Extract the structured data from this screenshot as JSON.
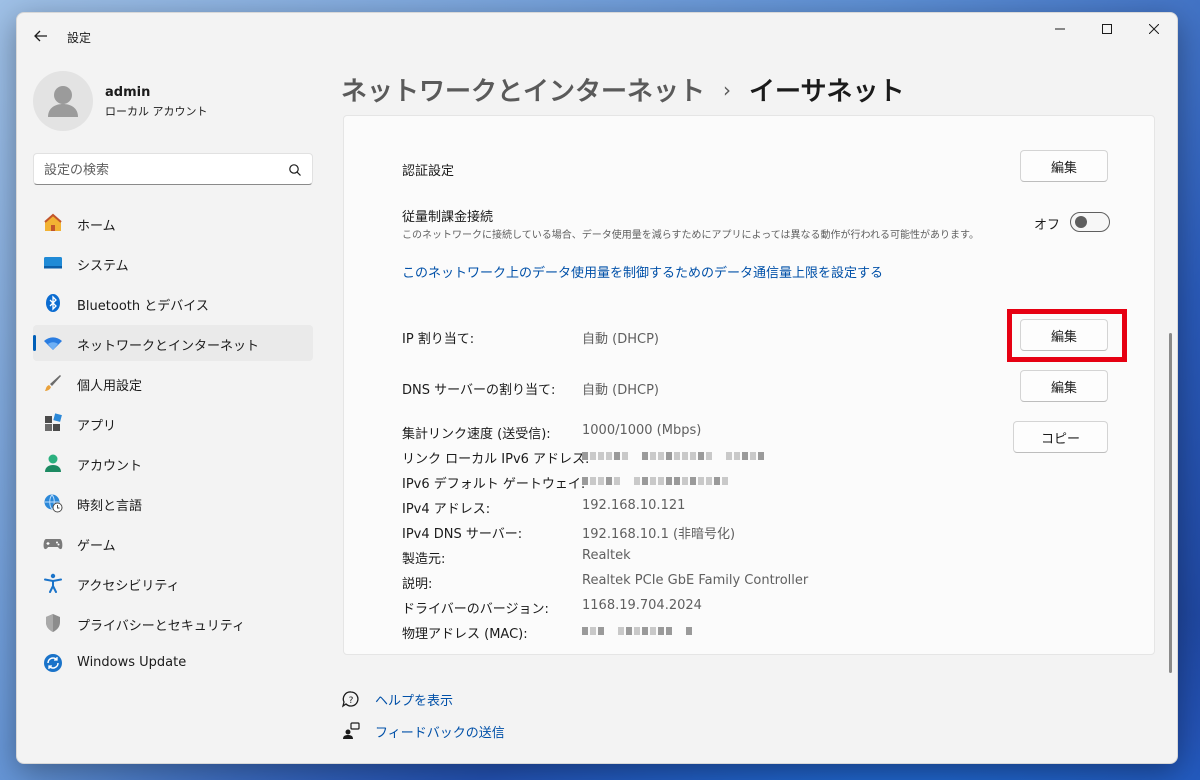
{
  "window": {
    "title": "設定"
  },
  "profile": {
    "name": "admin",
    "account_type": "ローカル アカウント"
  },
  "search": {
    "placeholder": "設定の検索"
  },
  "sidebar": {
    "items": [
      {
        "label": "ホーム",
        "icon": "home-icon"
      },
      {
        "label": "システム",
        "icon": "system-icon"
      },
      {
        "label": "Bluetooth とデバイス",
        "icon": "bluetooth-icon"
      },
      {
        "label": "ネットワークとインターネット",
        "icon": "wifi-icon",
        "active": true
      },
      {
        "label": "個人用設定",
        "icon": "brush-icon"
      },
      {
        "label": "アプリ",
        "icon": "apps-icon"
      },
      {
        "label": "アカウント",
        "icon": "account-icon"
      },
      {
        "label": "時刻と言語",
        "icon": "globe-clock-icon"
      },
      {
        "label": "ゲーム",
        "icon": "gamepad-icon"
      },
      {
        "label": "アクセシビリティ",
        "icon": "accessibility-icon"
      },
      {
        "label": "プライバシーとセキュリティ",
        "icon": "shield-icon"
      },
      {
        "label": "Windows Update",
        "icon": "update-icon"
      }
    ]
  },
  "header": {
    "parent": "ネットワークとインターネット",
    "separator": "›",
    "current": "イーサネット"
  },
  "settings": {
    "auth": {
      "label": "認証設定",
      "button": "編集"
    },
    "metered": {
      "label": "従量制課金接続",
      "description": "このネットワークに接続している場合、データ使用量を減らすためにアプリによっては異なる動作が行われる可能性があります。",
      "toggle_state": "オフ",
      "toggle_on": false
    },
    "data_limit_link": "このネットワーク上のデータ使用量を制御するためのデータ通信量上限を設定する",
    "ip_assign": {
      "label": "IP 割り当て:",
      "value": "自動 (DHCP)",
      "button": "編集"
    },
    "dns_assign": {
      "label": "DNS サーバーの割り当て:",
      "value": "自動 (DHCP)",
      "button": "編集"
    },
    "copy_button": "コピー",
    "properties": [
      {
        "label": "集計リンク速度 (送受信):",
        "value": "1000/1000 (Mbps)"
      },
      {
        "label": "リンク ローカル IPv6 アドレス:",
        "value": ""
      },
      {
        "label": "IPv6 デフォルト ゲートウェイ:",
        "value": ""
      },
      {
        "label": "IPv4 アドレス:",
        "value": "192.168.10.121"
      },
      {
        "label": "IPv4 DNS サーバー:",
        "value": "192.168.10.1 (非暗号化)"
      },
      {
        "label": "製造元:",
        "value": "Realtek"
      },
      {
        "label": "説明:",
        "value": "Realtek PCIe GbE Family Controller"
      },
      {
        "label": "ドライバーのバージョン:",
        "value": "1168.19.704.2024"
      },
      {
        "label": "物理アドレス (MAC):",
        "value": ""
      }
    ]
  },
  "footer": {
    "help": "ヘルプを表示",
    "feedback": "フィードバックの送信"
  },
  "colors": {
    "accent": "#005fb8",
    "link": "#0050a8",
    "highlight": "#e60012"
  }
}
